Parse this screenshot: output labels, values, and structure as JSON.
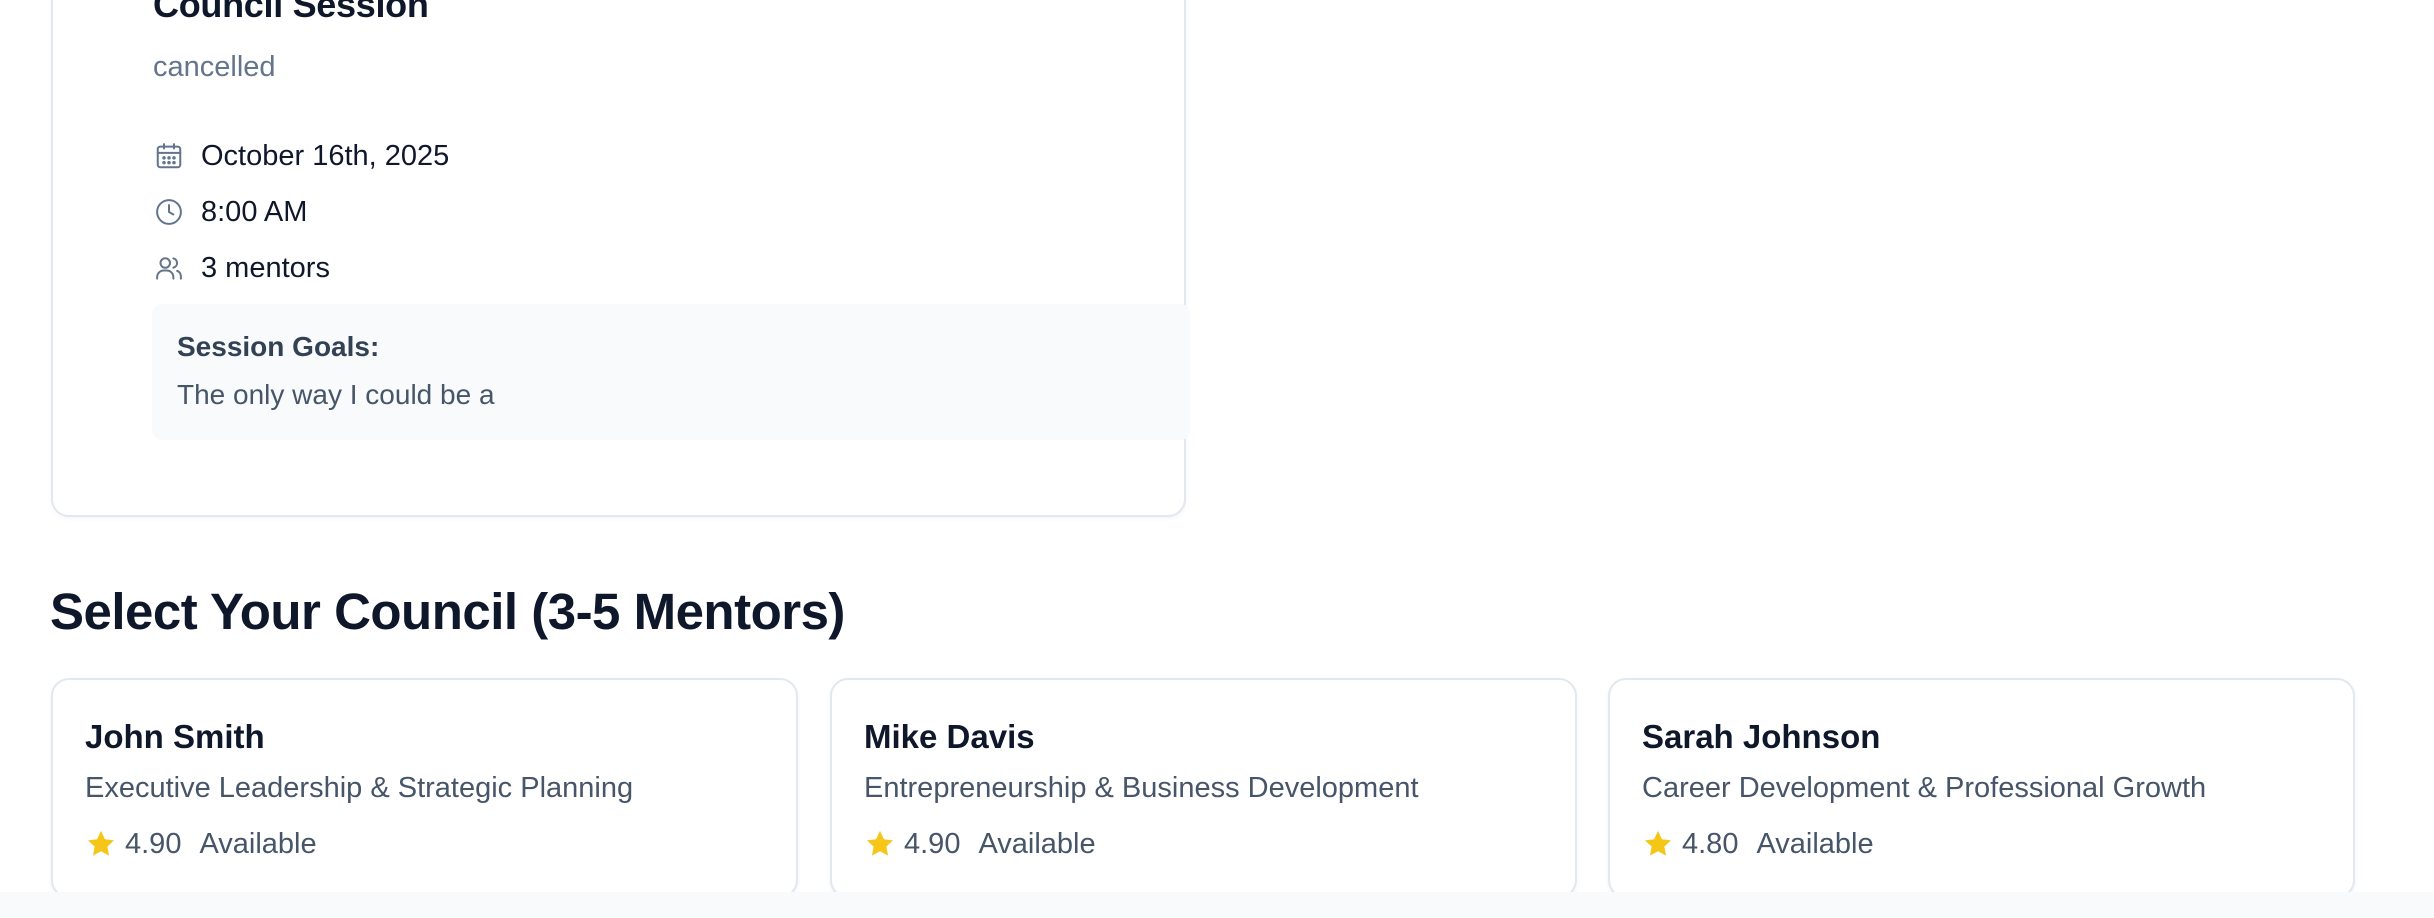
{
  "session": {
    "title": "Council Session",
    "status": "cancelled",
    "date": "October 16th, 2025",
    "time": "8:00 AM",
    "mentors": "3 mentors",
    "goals_label": "Session Goals:",
    "goals_text": "The only way I could be a",
    "icons": [
      "calendar-icon",
      "clock-icon",
      "users-icon"
    ]
  },
  "council": {
    "heading": "Select Your Council (3-5 Mentors)",
    "mentors": [
      {
        "name": "John Smith",
        "specialty": "Executive Leadership & Strategic Planning",
        "rating": "4.90",
        "availability": "Available"
      },
      {
        "name": "Mike Davis",
        "specialty": "Entrepreneurship & Business Development",
        "rating": "4.90",
        "availability": "Available"
      },
      {
        "name": "Sarah Johnson",
        "specialty": "Career Development & Professional Growth",
        "rating": "4.80",
        "availability": "Available"
      }
    ]
  },
  "colors": {
    "text_primary": "#0f172a",
    "text_muted": "#64748b",
    "border": "#e2e8f0",
    "goals_bg": "#f8fafc",
    "star": "#f5c518"
  }
}
